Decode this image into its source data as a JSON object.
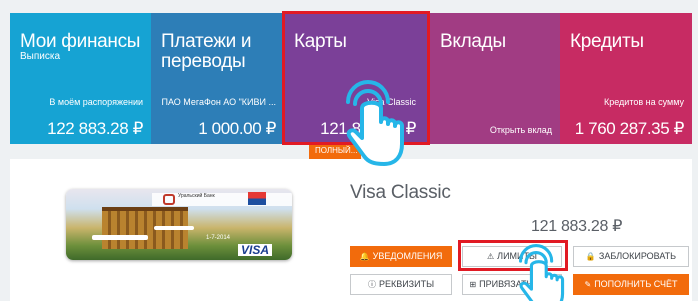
{
  "tiles": [
    {
      "title": "Мои финансы",
      "sub": "Выписка",
      "caption": "В моём распоряжении",
      "amount": "122 883.28 ₽"
    },
    {
      "title": "Платежи и переводы",
      "sub": "",
      "caption": "ПАО МегаФон АО \"КИВИ ...",
      "amount": "1 000.00 ₽"
    },
    {
      "title": "Карты",
      "sub": "",
      "caption": "Visa Classic",
      "amount": "121 883.28 ₽"
    },
    {
      "title": "Вклады",
      "sub": "",
      "caption": "Открыть вклад",
      "amount": ""
    },
    {
      "title": "Кредиты",
      "sub": "",
      "caption": "Кредитов на сумму",
      "amount": "1 760 287.35 ₽"
    }
  ],
  "selected_tab_label": "ПОЛНЫЙ...",
  "card": {
    "name": "Visa Classic",
    "balance": "121 883.28 ₽",
    "expiry": "1-7-2014",
    "brand": "VISA",
    "bank_text": "Уральский Банк"
  },
  "buttons": {
    "notifications": "УВЕДОМЛЕНИЯ",
    "limits": "ЛИМИТЫ",
    "block": "ЗАБЛОКИРОВАТЬ",
    "requisites": "РЕКВИЗИТЫ",
    "bind": "ПРИВЯЗАТЬ В...Д",
    "topup": "ПОПОЛНИТЬ СЧЁТ"
  },
  "icons": {
    "notifications": "bell-icon",
    "limits": "warning-icon",
    "block": "lock-icon",
    "requisites": "info-icon",
    "bind": "plus-icon",
    "topup": "pencil-icon"
  },
  "colors": {
    "accent": "#f26b0c",
    "highlight": "#e11a24",
    "tile_1": "#16a3d3",
    "tile_2": "#2d7eb7",
    "tile_3": "#7b4098",
    "tile_4": "#a13c83",
    "tile_5": "#c72b63"
  }
}
